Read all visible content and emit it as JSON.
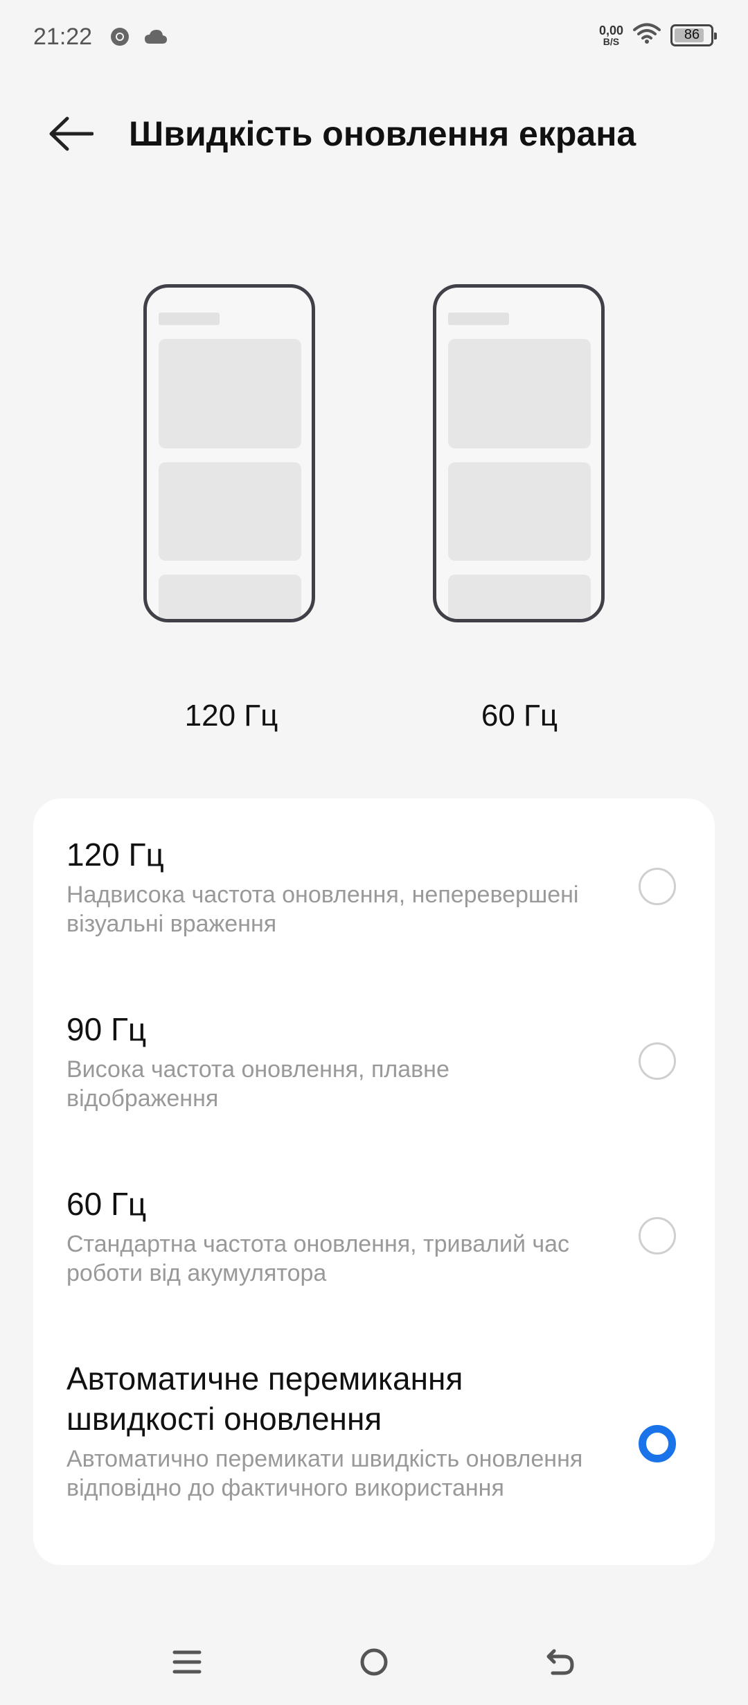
{
  "status": {
    "time": "21:22",
    "net_speed_value": "0,00",
    "net_speed_unit": "B/S",
    "battery": "86",
    "battery_level": 0.86,
    "left_icons": [
      "chrome-icon",
      "cloud-icon"
    ],
    "right_icons": [
      "wifi-icon",
      "battery-icon"
    ]
  },
  "header": {
    "title": "Швидкість оновлення екрана",
    "back_icon": "back-arrow-icon"
  },
  "preview": {
    "left_label": "120 Гц",
    "right_label": "60 Гц"
  },
  "options": [
    {
      "title": "120 Гц",
      "description": "Надвисока частота оновлення, неперевершені візуальні враження",
      "selected": false
    },
    {
      "title": "90 Гц",
      "description": "Висока частота оновлення, плавне відображення",
      "selected": false
    },
    {
      "title": "60 Гц",
      "description": "Стандартна частота оновлення, тривалий час роботи від акумулятора",
      "selected": false
    },
    {
      "title": "Автоматичне перемикання швидкості оновлення",
      "description": "Автоматично перемикати швидкість оновлення відповідно до фактичного використання",
      "selected": true
    }
  ],
  "colors": {
    "accent": "#1a73e8",
    "background": "#f5f5f5",
    "card": "#ffffff",
    "secondary_text": "#999999"
  },
  "nav": {
    "icons": [
      "menu-icon",
      "home-icon",
      "back-icon"
    ]
  }
}
